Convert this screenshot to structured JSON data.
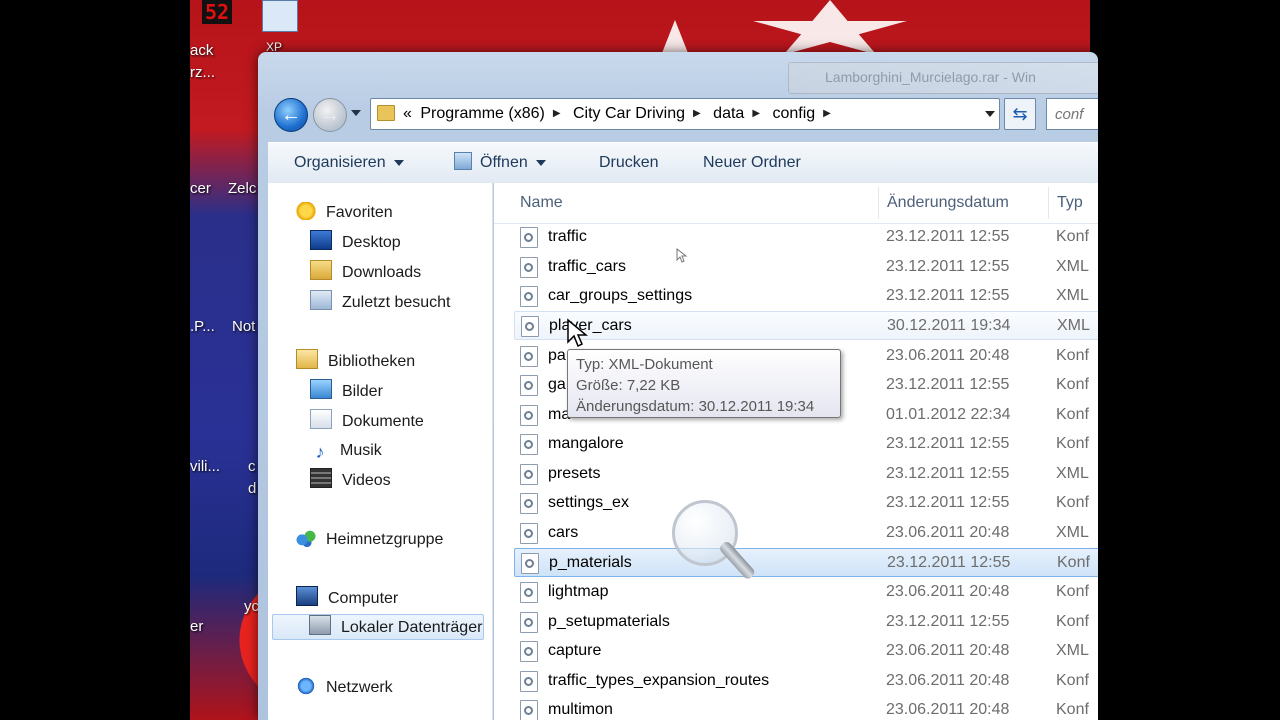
{
  "desktop": {
    "clock": "52",
    "icons": [
      "ack",
      "rz...",
      "cer",
      "Zelc",
      ".P...",
      "Not",
      "vili...",
      "c",
      "d",
      "yc",
      "er"
    ],
    "icon_top_label": "XP"
  },
  "ghost_window_title": "Lamborghini_Murcielago.rar - Win",
  "address": {
    "prefix": "«",
    "crumbs": [
      "Programme (x86)",
      "City Car Driving",
      "data",
      "config"
    ],
    "search_placeholder": "conf"
  },
  "toolbar": {
    "organize": "Organisieren",
    "open": "Öffnen",
    "print": "Drucken",
    "new_folder": "Neuer Ordner"
  },
  "nav": {
    "favorites": "Favoriten",
    "desktop": "Desktop",
    "downloads": "Downloads",
    "recent": "Zuletzt besucht",
    "libraries": "Bibliotheken",
    "pictures": "Bilder",
    "documents": "Dokumente",
    "music": "Musik",
    "videos": "Videos",
    "homegroup": "Heimnetzgruppe",
    "computer": "Computer",
    "local_disk": "Lokaler Datenträger",
    "network": "Netzwerk"
  },
  "columns": {
    "name": "Name",
    "date": "Änderungsdatum",
    "type": "Typ"
  },
  "files": [
    {
      "name": "traffic",
      "date": "23.12.2011 12:55",
      "type": "Konf"
    },
    {
      "name": "traffic_cars",
      "date": "23.12.2011 12:55",
      "type": "XML"
    },
    {
      "name": "car_groups_settings",
      "date": "23.12.2011 12:55",
      "type": "XML"
    },
    {
      "name": "player_cars",
      "date": "30.12.2011 19:34",
      "type": "XML"
    },
    {
      "name": "pa",
      "date": "23.06.2011 20:48",
      "type": "Konf"
    },
    {
      "name": "ga",
      "date": "23.12.2011 12:55",
      "type": "Konf"
    },
    {
      "name": "ma",
      "date": "01.01.2012 22:34",
      "type": "Konf"
    },
    {
      "name": "mangalore",
      "date": "23.12.2011 12:55",
      "type": "Konf"
    },
    {
      "name": "presets",
      "date": "23.12.2011 12:55",
      "type": "XML"
    },
    {
      "name": "settings_ex",
      "date": "23.12.2011 12:55",
      "type": "Konf"
    },
    {
      "name": "cars",
      "date": "23.06.2011 20:48",
      "type": "XML"
    },
    {
      "name": "p_materials",
      "date": "23.12.2011 12:55",
      "type": "Konf"
    },
    {
      "name": "lightmap",
      "date": "23.06.2011 20:48",
      "type": "Konf"
    },
    {
      "name": "p_setupmaterials",
      "date": "23.12.2011 12:55",
      "type": "Konf"
    },
    {
      "name": "capture",
      "date": "23.06.2011 20:48",
      "type": "XML"
    },
    {
      "name": "traffic_types_expansion_routes",
      "date": "23.06.2011 20:48",
      "type": "Konf"
    },
    {
      "name": "multimon",
      "date": "23.06.2011 20:48",
      "type": "Konf"
    }
  ],
  "tooltip": {
    "line1": "Typ: XML-Dokument",
    "line2": "Größe: 7,22 KB",
    "line3": "Änderungsdatum: 30.12.2011 19:34"
  }
}
